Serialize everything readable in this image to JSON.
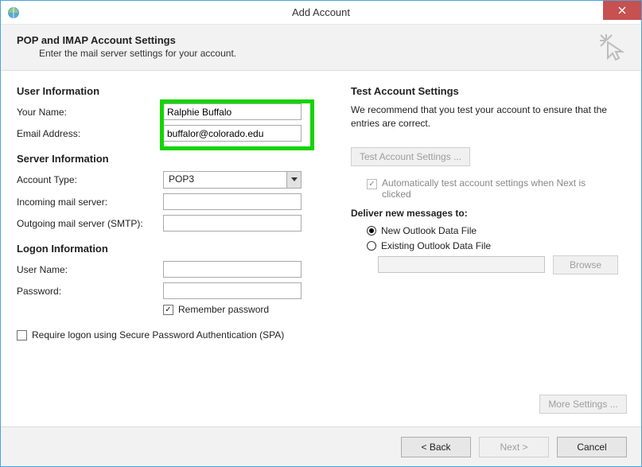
{
  "window": {
    "title": "Add Account"
  },
  "header": {
    "title": "POP and IMAP Account Settings",
    "subtitle": "Enter the mail server settings for your account."
  },
  "left": {
    "user_info_title": "User Information",
    "name_label": "Your Name:",
    "name_value": "Ralphie Buffalo",
    "email_label": "Email Address:",
    "email_value": "buffalor@colorado.edu",
    "server_info_title": "Server Information",
    "account_type_label": "Account Type:",
    "account_type_value": "POP3",
    "incoming_label": "Incoming mail server:",
    "incoming_value": "",
    "outgoing_label": "Outgoing mail server (SMTP):",
    "outgoing_value": "",
    "logon_info_title": "Logon Information",
    "username_label": "User Name:",
    "username_value": "",
    "password_label": "Password:",
    "password_value": "",
    "remember_label": "Remember password",
    "spa_label": "Require logon using Secure Password Authentication (SPA)"
  },
  "right": {
    "test_title": "Test Account Settings",
    "test_desc": "We recommend that you test your account to ensure that the entries are correct.",
    "test_btn": "Test Account Settings ...",
    "auto_test_label": "Automatically test account settings when Next is clicked",
    "deliver_title": "Deliver new messages to:",
    "deliver_new": "New Outlook Data File",
    "deliver_existing": "Existing Outlook Data File",
    "browse_btn": "Browse",
    "more_settings_btn": "More Settings ..."
  },
  "footer": {
    "back": "< Back",
    "next": "Next >",
    "cancel": "Cancel"
  }
}
